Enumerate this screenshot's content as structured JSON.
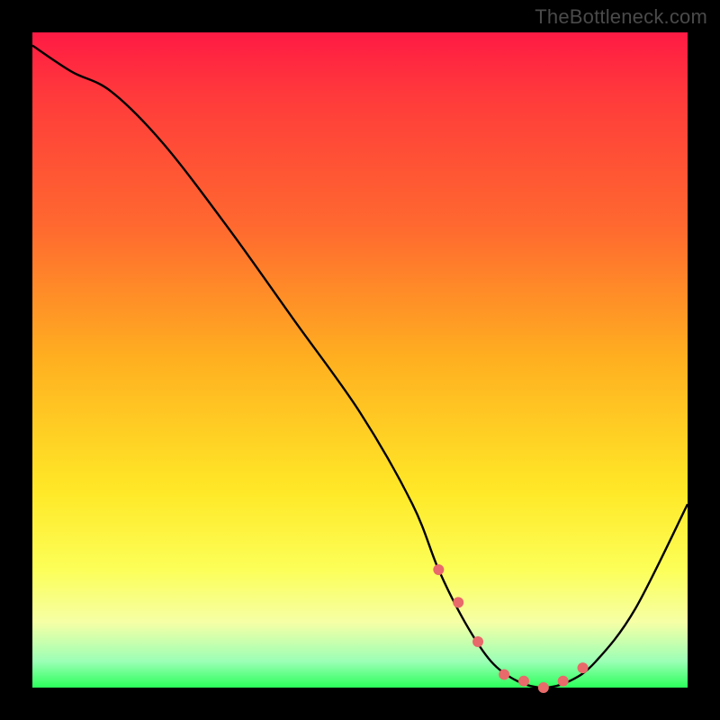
{
  "attribution": "TheBottleneck.com",
  "chart_data": {
    "type": "line",
    "title": "",
    "xlabel": "",
    "ylabel": "",
    "xlim": [
      0,
      100
    ],
    "ylim": [
      0,
      100
    ],
    "series": [
      {
        "name": "bottleneck-curve",
        "x": [
          0,
          6,
          12,
          20,
          30,
          40,
          50,
          58,
          62,
          66,
          70,
          74,
          78,
          82,
          86,
          92,
          100
        ],
        "values": [
          98,
          94,
          91,
          83,
          70,
          56,
          42,
          28,
          18,
          10,
          4,
          1,
          0,
          1,
          4,
          12,
          28
        ]
      }
    ],
    "markers": {
      "name": "highlight-near-minimum",
      "x": [
        62,
        65,
        68,
        72,
        75,
        78,
        81,
        84
      ],
      "values": [
        18,
        13,
        7,
        2,
        1,
        0,
        1,
        3
      ]
    }
  }
}
